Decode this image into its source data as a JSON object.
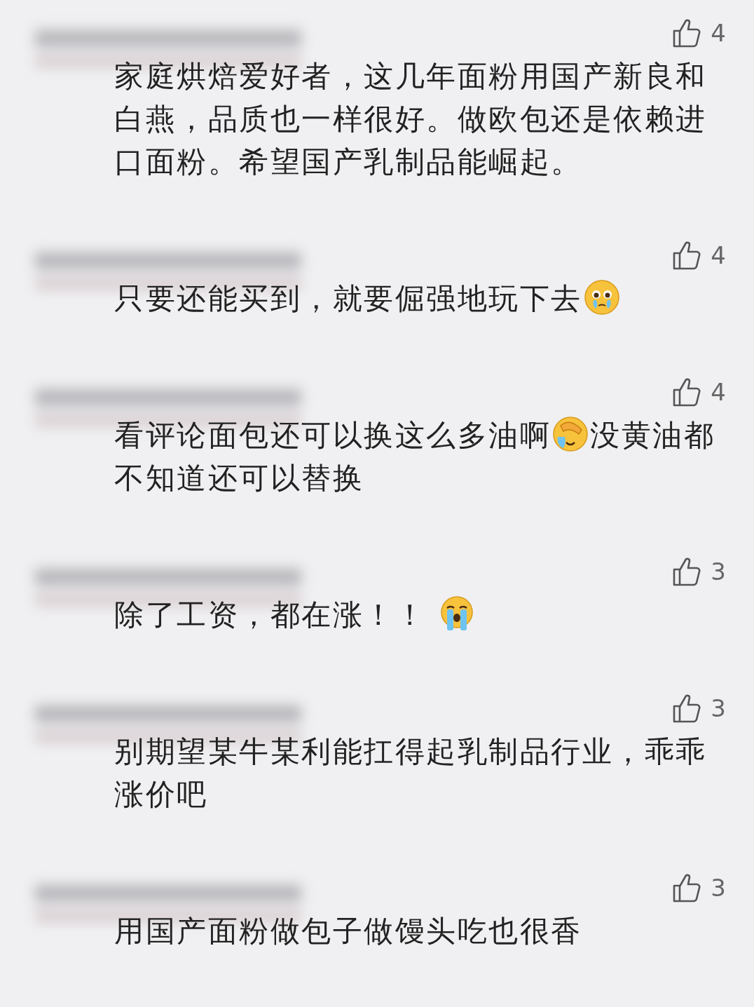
{
  "comments": [
    {
      "likes": "4",
      "parts": [
        {
          "kind": "text",
          "text": "家庭烘焙爱好者，这几年面粉用国产新良和白燕，品质也一样很好。做欧包还是依赖进口面粉。希望国产乳制品能崛起。"
        }
      ]
    },
    {
      "likes": "4",
      "parts": [
        {
          "kind": "text",
          "text": "只要还能买到，就要倔强地玩下去"
        },
        {
          "kind": "teary"
        }
      ]
    },
    {
      "likes": "4",
      "parts": [
        {
          "kind": "text",
          "text": "看评论面包还可以换这么多油啊"
        },
        {
          "kind": "facepalm"
        },
        {
          "kind": "text",
          "text": "没黄油都不知道还可以替换"
        }
      ]
    },
    {
      "likes": "3",
      "parts": [
        {
          "kind": "text",
          "text": "除了工资，都在涨！！ "
        },
        {
          "kind": "sobbing"
        }
      ]
    },
    {
      "likes": "3",
      "parts": [
        {
          "kind": "text",
          "text": "别期望某牛某利能扛得起乳制品行业，乖乖涨价吧"
        }
      ]
    },
    {
      "likes": "3",
      "parts": [
        {
          "kind": "text",
          "text": "用国产面粉做包子做馒头吃也很香"
        }
      ]
    }
  ]
}
